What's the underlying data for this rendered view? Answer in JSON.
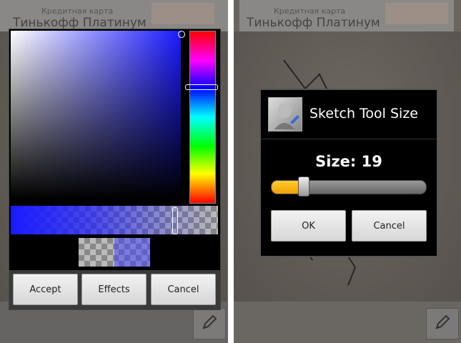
{
  "left_screen": {
    "ad": {
      "caption": "Кредитная карта",
      "title": "Тинькофф Платинум"
    },
    "color_picker": {
      "hue_color": "#1a1aff",
      "buttons": {
        "accept": "Accept",
        "effects": "Effects",
        "cancel": "Cancel"
      }
    },
    "tool_icon": "pencil-icon"
  },
  "right_screen": {
    "ad": {
      "caption": "Кредитная карта",
      "title": "Тинькофф Платинум"
    },
    "size_dialog": {
      "title": "Sketch Tool Size",
      "size_text": "Size: 19",
      "size_value": 19,
      "slider_fraction": 0.21,
      "buttons": {
        "ok": "OK",
        "cancel": "Cancel"
      }
    },
    "tool_icon": "pencil-icon"
  },
  "colors": {
    "slider_fill": "#f0a000",
    "dialog_bg": "#000000"
  }
}
